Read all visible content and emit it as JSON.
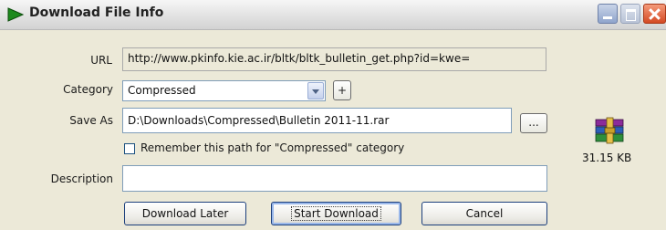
{
  "window": {
    "title": "Download File Info"
  },
  "form": {
    "url_label": "URL",
    "url_value": "http://www.pkinfo.kie.ac.ir/bltk/bltk_bulletin_get.php?id=kwe=",
    "category_label": "Category",
    "category_value": "Compressed",
    "add_category_label": "+",
    "save_as_label": "Save As",
    "save_as_value": "D:\\Downloads\\Compressed\\Bulletin 2011-11.rar",
    "browse_label": "...",
    "remember_label": "Remember this path for \"Compressed\" category",
    "remember_checked": false,
    "description_label": "Description",
    "description_value": ""
  },
  "file": {
    "icon": "winrar-archive-icon",
    "size": "31.15 KB"
  },
  "buttons": {
    "download_later": "Download Later",
    "start_download": "Start Download",
    "cancel": "Cancel"
  }
}
